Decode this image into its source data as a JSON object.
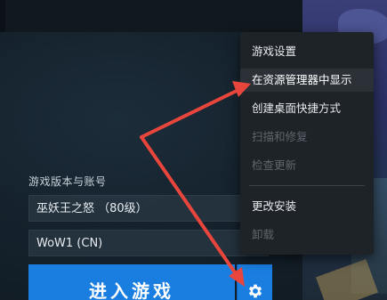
{
  "launcher": {
    "section_label": "游戏版本与账号",
    "version_select": "巫妖王之怒 （80级）",
    "account_select": "WoW1 (CN)",
    "play_button": "进入游戏",
    "settings_icon": "gear-icon"
  },
  "context_menu": {
    "items": [
      {
        "label": "游戏设置",
        "enabled": true
      },
      {
        "label": "在资源管理器中显示",
        "enabled": true,
        "highlighted": true
      },
      {
        "label": "创建桌面快捷方式",
        "enabled": true
      },
      {
        "label": "扫描和修复",
        "enabled": false
      },
      {
        "label": "检查更新",
        "enabled": false
      },
      {
        "label": "更改安装",
        "enabled": true
      },
      {
        "label": "卸载",
        "enabled": false
      }
    ]
  },
  "colors": {
    "primary_button": "#1a7de0",
    "menu_background": "#1e2328",
    "annotation_arrow": "#e8463c",
    "disabled_text": "#5e666d"
  }
}
